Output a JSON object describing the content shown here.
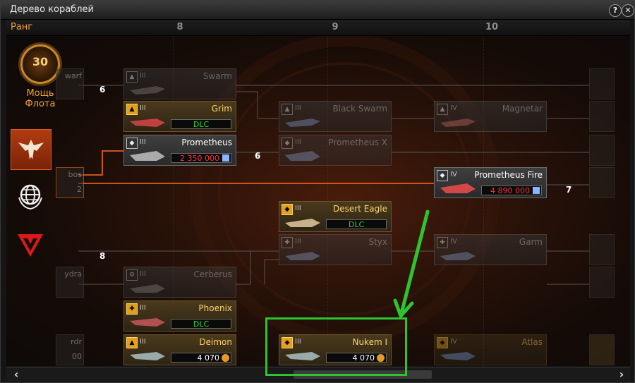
{
  "window": {
    "title": "Дерево кораблей",
    "help_label": "?",
    "close_label": "✕"
  },
  "header": {
    "rank_label": "Ранг",
    "columns": [
      "8",
      "9",
      "10"
    ]
  },
  "sidebar": {
    "rank_value": "30",
    "power_label_1": "Мощь",
    "power_label_2": "Флота",
    "nav": [
      {
        "name": "faction-eagle",
        "active": true
      },
      {
        "name": "faction-globe",
        "active": false
      },
      {
        "name": "faction-red",
        "active": false
      }
    ]
  },
  "left_stubs": [
    "warf",
    "bos",
    "2",
    "ydra",
    "rdr",
    "00"
  ],
  "counts": {
    "c1": "6",
    "c2": "6",
    "c3": "7",
    "c4": "8"
  },
  "ships": {
    "swarm": {
      "name": "Swarm",
      "tier": "III"
    },
    "grim": {
      "name": "Grim",
      "tier": "III",
      "price": "DLC"
    },
    "prometheus": {
      "name": "Prometheus",
      "tier": "III",
      "price": "2 350 000"
    },
    "black_swarm": {
      "name": "Black Swarm",
      "tier": "III"
    },
    "prometheus_x": {
      "name": "Prometheus X",
      "tier": "III"
    },
    "magnetar": {
      "name": "Magnetar",
      "tier": "IV"
    },
    "prometheus_fire": {
      "name": "Prometheus Fire",
      "tier": "IV",
      "price": "4 890 000"
    },
    "desert_eagle": {
      "name": "Desert Eagle",
      "tier": "III",
      "price": "DLC"
    },
    "styx": {
      "name": "Styx",
      "tier": "III"
    },
    "garm": {
      "name": "Garm",
      "tier": "IV"
    },
    "cerberus": {
      "name": "Cerberus",
      "tier": "III"
    },
    "phoenix": {
      "name": "Phoenix",
      "tier": "III",
      "price": "DLC"
    },
    "deimon": {
      "name": "Deimon",
      "tier": "III",
      "price": "4 070"
    },
    "nukem": {
      "name": "Nukem I",
      "tier": "III",
      "price": "4 070"
    },
    "atlas": {
      "name": "Atlas",
      "tier": "IV"
    }
  },
  "colors": {
    "accent": "#f0a030",
    "highlight": "#2ec42e",
    "link": "#ff6a20",
    "dlc": "#2ad52a",
    "price_red": "#ff3030"
  }
}
